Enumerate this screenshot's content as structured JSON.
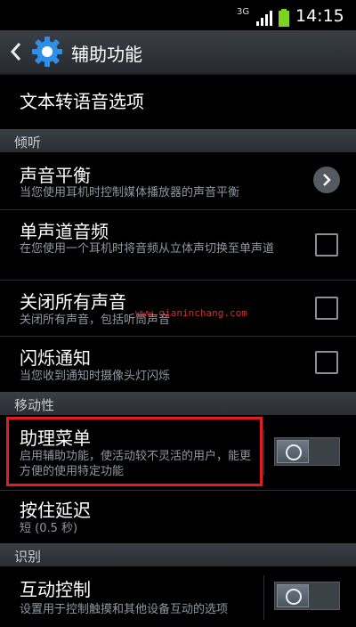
{
  "status": {
    "network": "3G",
    "time": "14:15"
  },
  "action_bar": {
    "title": "辅助功能"
  },
  "items": {
    "tts": {
      "title": "文本转语音选项"
    },
    "sound_balance": {
      "title": "声音平衡",
      "sub": "当您使用耳机时控制媒体播放器的声音平衡"
    },
    "mono_audio": {
      "title": "单声道音频",
      "sub": "在您使用一个耳机时将音频从立体声切换至单声道",
      "checked": false
    },
    "mute_all": {
      "title": "关闭所有声音",
      "sub": "关闭所有声音，包括听筒声音",
      "checked": false
    },
    "flash_notify": {
      "title": "闪烁通知",
      "sub": "当您收到通知时摄像头灯闪烁",
      "checked": false
    },
    "assistant_menu": {
      "title": "助理菜单",
      "sub": "启用辅助功能，使活动较不灵活的用户，能更方便的使用特定功能",
      "on": false
    },
    "hold_delay": {
      "title": "按住延迟",
      "sub": "短 (0.5 秒)"
    },
    "interaction_control": {
      "title": "互动控制",
      "sub": "设置用于控制触摸和其他设备互动的选项",
      "on": false
    }
  },
  "sections": {
    "hearing": "倾听",
    "mobility": "移动性",
    "recognition": "识别"
  },
  "watermark": "www.qianinchang.com",
  "colors": {
    "highlight": "#e31b23",
    "subtext": "#8e98a3",
    "section_bg": "#2f3338"
  }
}
